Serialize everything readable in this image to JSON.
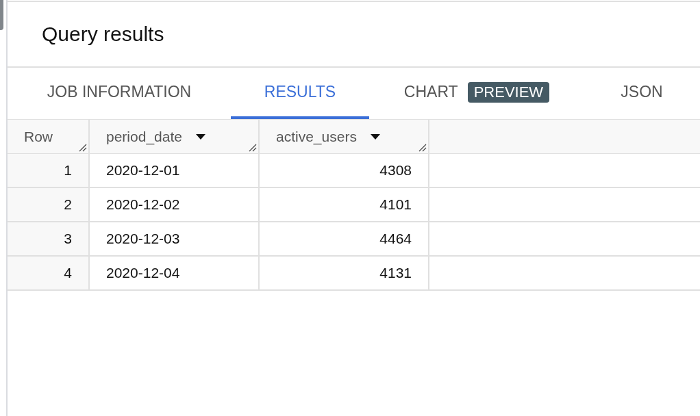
{
  "title": "Query results",
  "tabs": [
    {
      "label": "JOB INFORMATION",
      "selected": false
    },
    {
      "label": "RESULTS",
      "selected": true
    },
    {
      "label": "CHART",
      "selected": false,
      "badge": "PREVIEW"
    },
    {
      "label": "JSON",
      "selected": false
    }
  ],
  "table": {
    "columns": [
      {
        "label": "Row",
        "menu": false
      },
      {
        "label": "period_date",
        "menu": true
      },
      {
        "label": "active_users",
        "menu": true
      }
    ],
    "rows": [
      [
        "1",
        "2020-12-01",
        "4308"
      ],
      [
        "2",
        "2020-12-02",
        "4101"
      ],
      [
        "3",
        "2020-12-03",
        "4464"
      ],
      [
        "4",
        "2020-12-04",
        "4131"
      ]
    ]
  }
}
